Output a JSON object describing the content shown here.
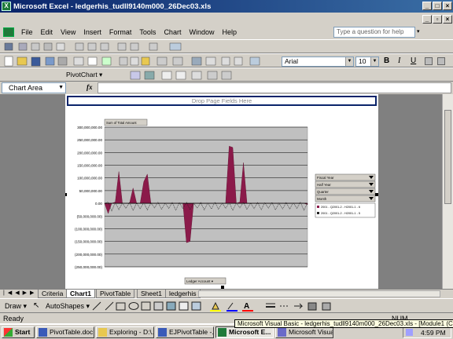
{
  "window": {
    "title": "Microsoft Excel - ledgerhis_tudll9140m000_26Dec03.xls"
  },
  "menubar": {
    "items": [
      "File",
      "Edit",
      "View",
      "Insert",
      "Format",
      "Tools",
      "Chart",
      "Window",
      "Help"
    ],
    "ask_placeholder": "Type a question for help"
  },
  "formatting": {
    "font": "Arial",
    "size": "10",
    "bold": "B",
    "italic": "I",
    "underline": "U"
  },
  "pivot_toolbar": {
    "label": "PivotChart ▾"
  },
  "namebox": {
    "value": "Chart Area",
    "fx": "fx"
  },
  "pivot": {
    "page_drop": "Drop Page Fields Here",
    "data_field": "Sum of Total Amount",
    "category_field": "Ledger Account ▾",
    "series_fields": [
      "Fiscal Year",
      "Half Year",
      "Quarter",
      "Month"
    ],
    "legend_entries": [
      "2001 - Q2001-2 - H2001-1 - 6",
      "2001 - Q2001-2 - H2001-1 - 5"
    ]
  },
  "chart_data": {
    "type": "area",
    "title": "",
    "xlabel": "",
    "ylabel": "",
    "ylim": [
      -250000000,
      300000000
    ],
    "y_ticks": [
      "300,000,000.00",
      "250,000,000.00",
      "200,000,000.00",
      "150,000,000.00",
      "100,000,000.00",
      "50,000,000.00",
      "0.00",
      "(50,000,000.00)",
      "(100,000,000.00)",
      "(150,000,000.00)",
      "(200,000,000.00)",
      "(250,000,000.00)"
    ],
    "grid": true,
    "legend_position": "right",
    "series": [
      {
        "name": "2001 - Q2001-2 - H2001-1 - 6",
        "color": "#8b1a4a",
        "values": [
          0,
          -40000000,
          0,
          5000000,
          125000000,
          0,
          0,
          0,
          60000000,
          0,
          0,
          85000000,
          115000000,
          0,
          0,
          0,
          0,
          0,
          0,
          0,
          0,
          0,
          0,
          -155000000,
          -150000000,
          0,
          0,
          0,
          0,
          0,
          0,
          0,
          0,
          0,
          0,
          225000000,
          220000000,
          0,
          5000000,
          160000000,
          0,
          0,
          0,
          0,
          0,
          0,
          0,
          0,
          0,
          0,
          0,
          0,
          0,
          0,
          0,
          0,
          0,
          -5000000
        ]
      },
      {
        "name": "2001 - Q2001-2 - H2001-1 - 5",
        "color": "#222222",
        "values": [
          0,
          5000000,
          -30000000,
          3000000,
          -25000000,
          2000000,
          -20000000,
          4000000,
          -28000000,
          1000000,
          -22000000,
          3000000,
          -26000000,
          2000000,
          -18000000,
          4000000,
          -24000000,
          1000000,
          -20000000,
          3000000,
          -27000000,
          2000000,
          -21000000,
          4000000,
          -25000000,
          1000000,
          -19000000,
          3000000,
          -26000000,
          2000000,
          -22000000,
          4000000,
          -23000000,
          1000000,
          -20000000,
          3000000,
          -28000000,
          2000000,
          -18000000,
          4000000,
          -24000000,
          1000000,
          -21000000,
          3000000,
          -25000000,
          2000000,
          -19000000,
          4000000,
          -26000000,
          1000000,
          -22000000,
          3000000,
          -23000000,
          2000000,
          -20000000,
          4000000,
          -27000000,
          0
        ]
      }
    ]
  },
  "tabs": {
    "items": [
      "Criteria",
      "Chart1",
      "PivotTable",
      "Sheet1",
      "ledgerhis"
    ],
    "active": 1
  },
  "drawbar": {
    "draw": "Draw ▾",
    "autoshapes": "AutoShapes ▾"
  },
  "status": {
    "left": "Ready",
    "num": "NUM"
  },
  "taskbar": {
    "start": "Start",
    "tasks": [
      "PivotTable.doc...",
      "Exploring - D:\\...",
      "EJPivotTable -...",
      "Microsoft E...",
      "Microsoft Visua..."
    ],
    "tooltip": "Microsoft Visual Basic - ledgerhis_tudll9140m000_26Dec03.xls - [Module1 (Code)]",
    "clock": "4:59 PM"
  },
  "colors": {
    "titlebar": "#0a246a",
    "plot_bg": "#c0c0c0",
    "series_area": "#8b1a4a"
  }
}
